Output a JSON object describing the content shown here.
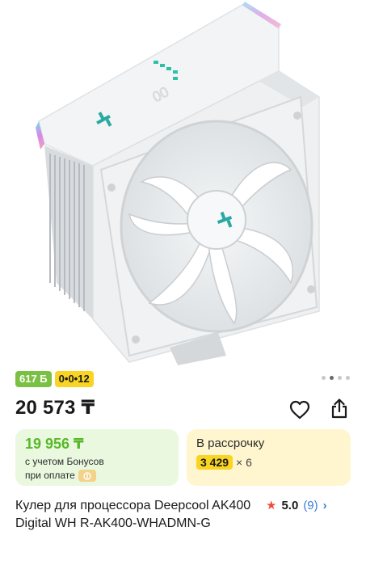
{
  "product": {
    "title": "Кулер для процессора Deepcool AK400 Digital WH R-AK400-WHADMN-G",
    "price": "20 573 ₸",
    "image_alt": "white CPU cooler",
    "badges": {
      "bonus": "617 Б",
      "installment": "0•0•12"
    }
  },
  "gallery": {
    "total_dots": 4,
    "active_index": 0
  },
  "bonus_card": {
    "price": "19 956 ₸",
    "line1": "с учетом Бонусов",
    "line2": "при оплате"
  },
  "installment_card": {
    "title": "В рассрочку",
    "amount": "3 429",
    "multiplier": "× 6"
  },
  "rating": {
    "score": "5.0",
    "count": "(9)"
  },
  "icons": {
    "favorite": "heart-icon",
    "share": "share-icon",
    "star": "star-icon",
    "chevron": "chevron-right-icon",
    "bonus": "bonus-coin-icon"
  },
  "colors": {
    "bonus_green": "#7ac143",
    "bonus_text_green": "#59b82a",
    "installment_yellow": "#f9d423",
    "green_card_bg": "#e9f8df",
    "yellow_card_bg": "#fff6cf",
    "star_red": "#f04b3a",
    "link_blue": "#3d7bd9"
  }
}
